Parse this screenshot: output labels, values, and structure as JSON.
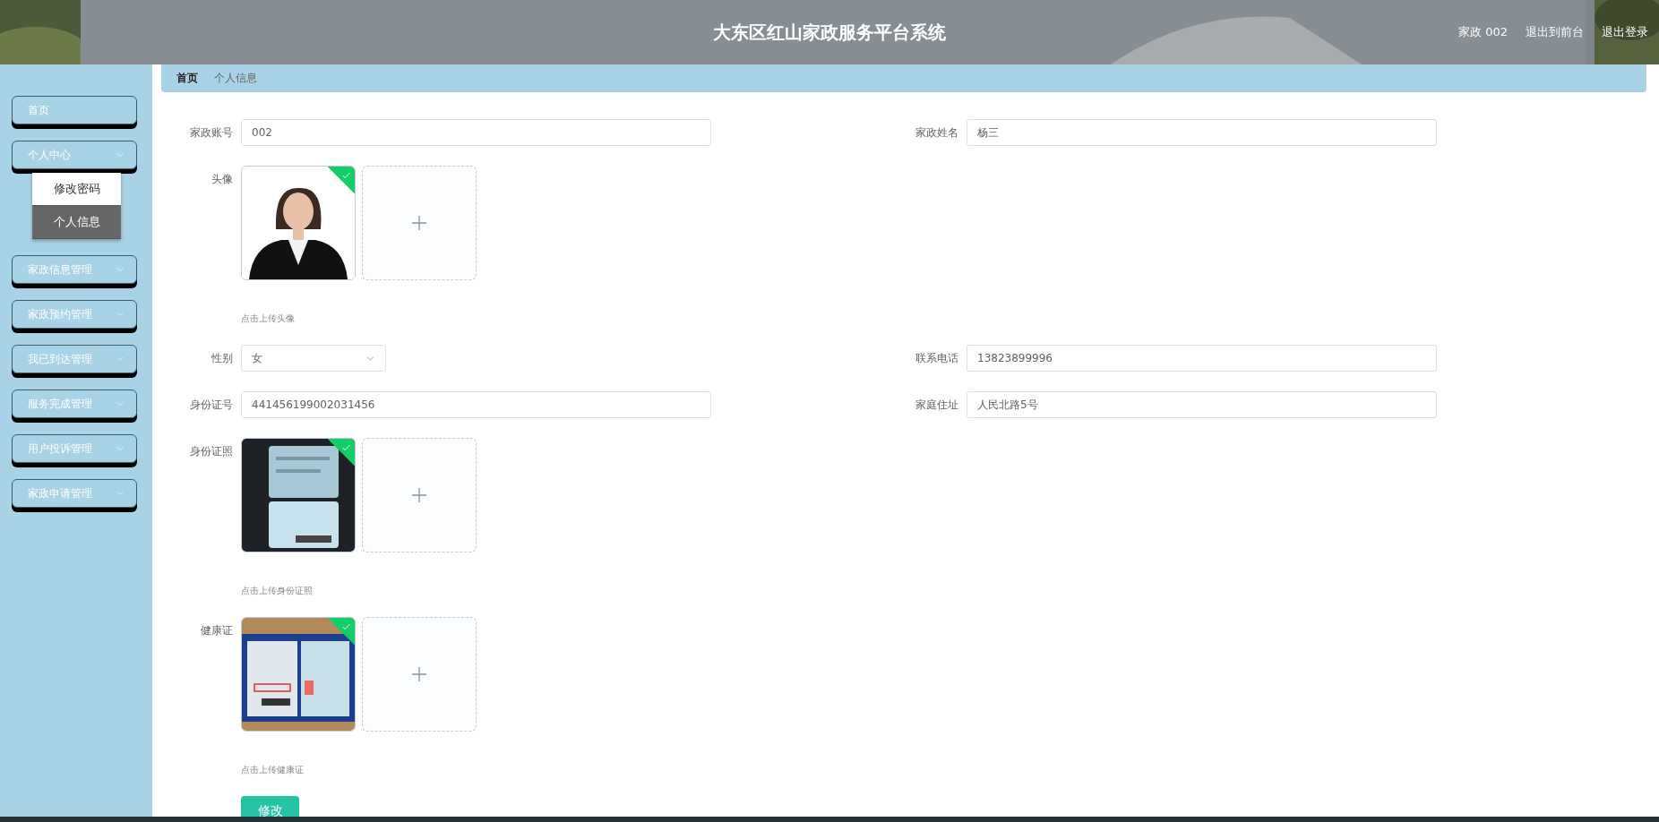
{
  "header": {
    "title": "大东区红山家政服务平台系统",
    "user": "家政 002",
    "links": [
      "退出到前台",
      "退出登录"
    ]
  },
  "sidebar": {
    "items": [
      {
        "kind": "link",
        "label": "首页"
      },
      {
        "kind": "menu",
        "label": "个人中心",
        "children": [
          {
            "label": "修改密码",
            "selected": false
          },
          {
            "label": "个人信息",
            "selected": true
          }
        ]
      },
      {
        "kind": "menu",
        "label": "家政信息管理"
      },
      {
        "kind": "menu",
        "label": "家政预约管理"
      },
      {
        "kind": "menu",
        "label": "我已到达管理"
      },
      {
        "kind": "menu",
        "label": "服务完成管理"
      },
      {
        "kind": "menu",
        "label": "用户投诉管理"
      },
      {
        "kind": "menu",
        "label": "家政申请管理"
      }
    ]
  },
  "breadcrumb": [
    "首页",
    "个人信息"
  ],
  "form": {
    "rows": [
      [
        {
          "kind": "input",
          "label": "家政账号",
          "value": "002"
        },
        {
          "kind": "input",
          "label": "家政姓名",
          "value": "杨三"
        }
      ],
      [
        {
          "kind": "upload",
          "label": "头像",
          "uploaded": true,
          "hint": "点击上传头像"
        }
      ],
      [
        {
          "kind": "select",
          "label": "性别",
          "value": "女"
        },
        {
          "kind": "input",
          "label": "联系电话",
          "value": "13823899996"
        }
      ],
      [
        {
          "kind": "input",
          "label": "身份证号",
          "value": "441456199002031456"
        },
        {
          "kind": "input",
          "label": "家庭住址",
          "value": "人民北路5号"
        }
      ],
      [
        {
          "kind": "upload",
          "label": "身份证照",
          "uploaded": true,
          "hint": "点击上传身份证照"
        }
      ],
      [
        {
          "kind": "upload",
          "label": "健康证",
          "uploaded": true,
          "hint": "点击上传健康证"
        }
      ]
    ],
    "submit": "修改"
  }
}
